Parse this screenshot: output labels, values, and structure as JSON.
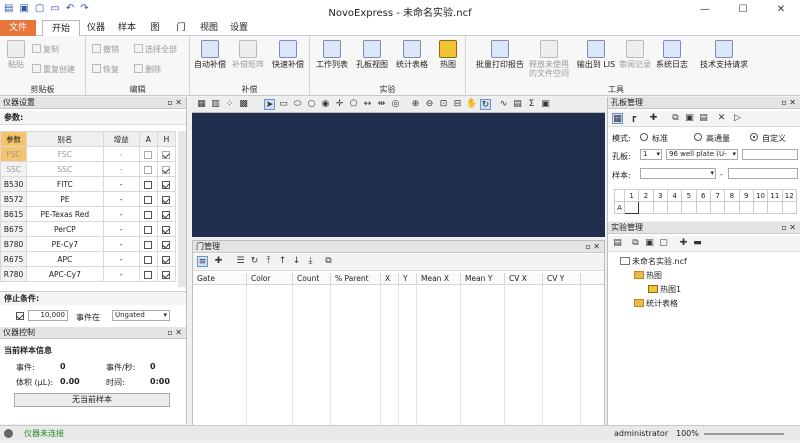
{
  "window": {
    "title": "NovoExpress - 未命名实验.ncf"
  },
  "menu": {
    "file": "文件",
    "tabs": [
      "开始",
      "仪器",
      "样本",
      "图",
      "门",
      "视图",
      "设置"
    ]
  },
  "ribbon": {
    "groups": [
      "剪贴板",
      "编辑",
      "补偿",
      "实验",
      "工具"
    ],
    "clipboard": {
      "paste": "粘贴",
      "copy": "复制",
      "duplicate": "重复创建"
    },
    "edit": {
      "undo": "撤销",
      "redo": "恢复",
      "select_all": "选择全部",
      "delete": "删除"
    },
    "comp": {
      "auto": "自动补偿",
      "matrix": "补偿矩阵",
      "quick": "快速补偿"
    },
    "experiment": {
      "worklist": "工作列表",
      "plate_view": "孔板视图",
      "stats": "统计表格",
      "heatmap": "热图"
    },
    "tools": {
      "batch_print": "批量打印报告",
      "release": "释放未使用的文件空间",
      "export_lis": "输出到 LIS",
      "audit": "审阅记录",
      "syslog": "系统日志",
      "support": "技术支持请求"
    }
  },
  "instrument_settings": {
    "header": "仪器设置",
    "section": "参数:",
    "columns": [
      "参数",
      "别名",
      "增益",
      "A",
      "H"
    ],
    "rows": [
      {
        "param": "FSC",
        "alias": "FSC",
        "gain": "-",
        "A": false,
        "H": true
      },
      {
        "param": "SSC",
        "alias": "SSC",
        "gain": "-",
        "A": false,
        "H": true
      },
      {
        "param": "B530",
        "alias": "FITC",
        "gain": "-",
        "A": false,
        "H": true
      },
      {
        "param": "B572",
        "alias": "PE",
        "gain": "-",
        "A": false,
        "H": true
      },
      {
        "param": "B615",
        "alias": "PE-Texas Red",
        "gain": "-",
        "A": false,
        "H": true
      },
      {
        "param": "B675",
        "alias": "PerCP",
        "gain": "-",
        "A": false,
        "H": true
      },
      {
        "param": "B780",
        "alias": "PE-Cy7",
        "gain": "-",
        "A": false,
        "H": true
      },
      {
        "param": "R675",
        "alias": "APC",
        "gain": "-",
        "A": false,
        "H": true
      },
      {
        "param": "R780",
        "alias": "APC-Cy7",
        "gain": "-",
        "A": false,
        "H": true
      }
    ],
    "stop_label": "停止条件:",
    "stop_value": "10,000",
    "stop_in": "事件在",
    "stop_gate": "Ungated"
  },
  "instrument_control": {
    "header": "仪器控制",
    "section": "当前样本信息",
    "events_label": "事件:",
    "events_value": "0",
    "rate_label": "事件/秒:",
    "rate_value": "0",
    "volume_label": "体积 (µL):",
    "volume_value": "0.00",
    "time_label": "时间:",
    "time_value": "0:00",
    "no_sample": "无当前样本"
  },
  "gate_manager": {
    "header": "门管理",
    "columns": [
      "Gate",
      "Color",
      "Count",
      "% Parent",
      "X",
      "Y",
      "Mean X",
      "Mean Y",
      "CV X",
      "CV Y"
    ]
  },
  "plate_manager": {
    "header": "孔板管理",
    "mode_label": "模式:",
    "modes": [
      "标准",
      "高通量",
      "自定义"
    ],
    "plate_label": "孔板:",
    "plate_num": "1",
    "plate_type": "96 well plate (U-",
    "sample_label": "样本:",
    "cols": [
      "1",
      "2",
      "3",
      "4",
      "5",
      "6",
      "7",
      "8",
      "9",
      "10",
      "11",
      "12"
    ],
    "row_a": "A"
  },
  "experiment_manager": {
    "header": "实验管理",
    "root": "未命名实验.ncf",
    "heatmap_folder": "热图",
    "heatmap_item": "热图1",
    "stats_folder": "统计表格"
  },
  "status": {
    "connection": "仪器未连接",
    "user": "administrator",
    "zoom": "100%"
  }
}
